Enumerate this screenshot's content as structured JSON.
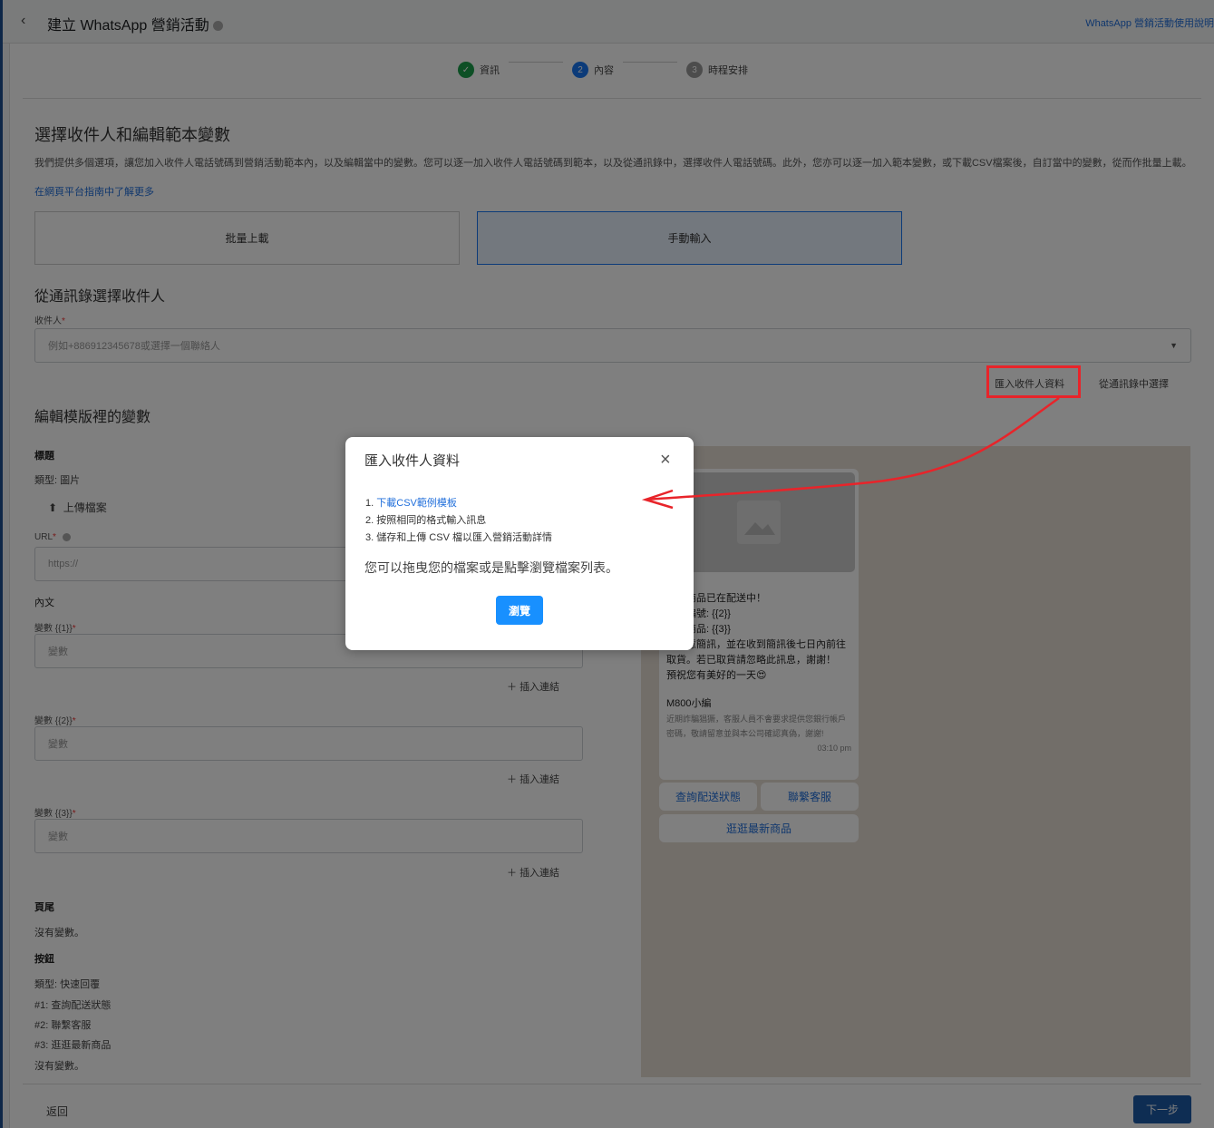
{
  "header": {
    "back_icon": "‹",
    "title": "建立 WhatsApp 營銷活動",
    "help_link": "WhatsApp 營銷活動使用說明"
  },
  "stepper": [
    {
      "label": "資訊",
      "state": "done",
      "num": "✓"
    },
    {
      "label": "內容",
      "state": "active",
      "num": "2"
    },
    {
      "label": "時程安排",
      "state": "pending",
      "num": "3"
    }
  ],
  "section1": {
    "title": "選擇收件人和編輯範本變數",
    "description": "我們提供多個選項，讓您加入收件人電話號碼到營銷活動範本內，以及編輯當中的變數。您可以逐一加入收件人電話號碼到範本，以及從通訊錄中，選擇收件人電話號碼。此外，您亦可以逐一加入範本變數，或下載CSV檔案後，自訂當中的變數，從而作批量上載。",
    "learn_more": "在網頁平台指南中了解更多",
    "options": [
      "批量上載",
      "手動輸入"
    ]
  },
  "recipients": {
    "title": "從通訊錄選擇收件人",
    "label": "收件人",
    "placeholder": "例如+886912345678或選擇一個聯絡人",
    "import_link": "匯入收件人資料",
    "contacts_link": "從通訊錄中選擇"
  },
  "variables": {
    "title": "編輯模版裡的變數",
    "header_label": "標題",
    "header_type": "類型: 圖片",
    "upload": "上傳檔案",
    "url_label": "URL",
    "url_placeholder": "https://",
    "body_label": "內文",
    "vars": [
      {
        "label": "變數 {{1}}",
        "placeholder": "變數",
        "insert": "插入連結"
      },
      {
        "label": "變數 {{2}}",
        "placeholder": "變數",
        "insert": "插入連結"
      },
      {
        "label": "變數 {{3}}",
        "placeholder": "變數",
        "insert": "插入連結"
      }
    ],
    "footer_label": "頁尾",
    "footer_none": "沒有變數。",
    "buttons_label": "按鈕",
    "buttons_type": "類型: 快速回覆",
    "buttons": [
      "#1: 查詢配送狀態",
      "#2: 聯繫客服",
      "#3: 逛逛最新商品"
    ],
    "buttons_none": "沒有變數。"
  },
  "preview": {
    "lines": [
      "{{1}}",
      "您的商品已在配送中！",
      "訂單編號: {{2}}",
      "配送商品: {{3}}",
      "請留意簡訊，並在收到簡訊後七日內前往取貨。若已取貨請忽略此訊息，謝謝！",
      "預祝您有美好的一天😍"
    ],
    "footer_title": "M800小編",
    "footer_note": "近期詐騙猖獗，客服人員不會要求提供您銀行帳戶密碼，敬請留意並與本公司確認真偽，謝謝!",
    "time": "03:10 pm",
    "quick_replies": [
      "查詢配送狀態",
      "聯繫客服",
      "逛逛最新商品"
    ]
  },
  "footer": {
    "back": "返回",
    "next": "下一步"
  },
  "modal": {
    "title": "匯入收件人資料",
    "close": "×",
    "step1_num": "1.",
    "step1_link": "下載CSV範例模板",
    "step2": "2. 按照相同的格式輸入訊息",
    "step3": "3. 儲存和上傳 CSV 檔以匯入營銷活動詳情",
    "drop_text": "您可以拖曳您的檔案或是點擊瀏覽檔案列表。",
    "browse": "瀏覽"
  },
  "colors": {
    "accent": "#1877f2",
    "success": "#1a9e4b",
    "annotation": "#e8242a"
  }
}
